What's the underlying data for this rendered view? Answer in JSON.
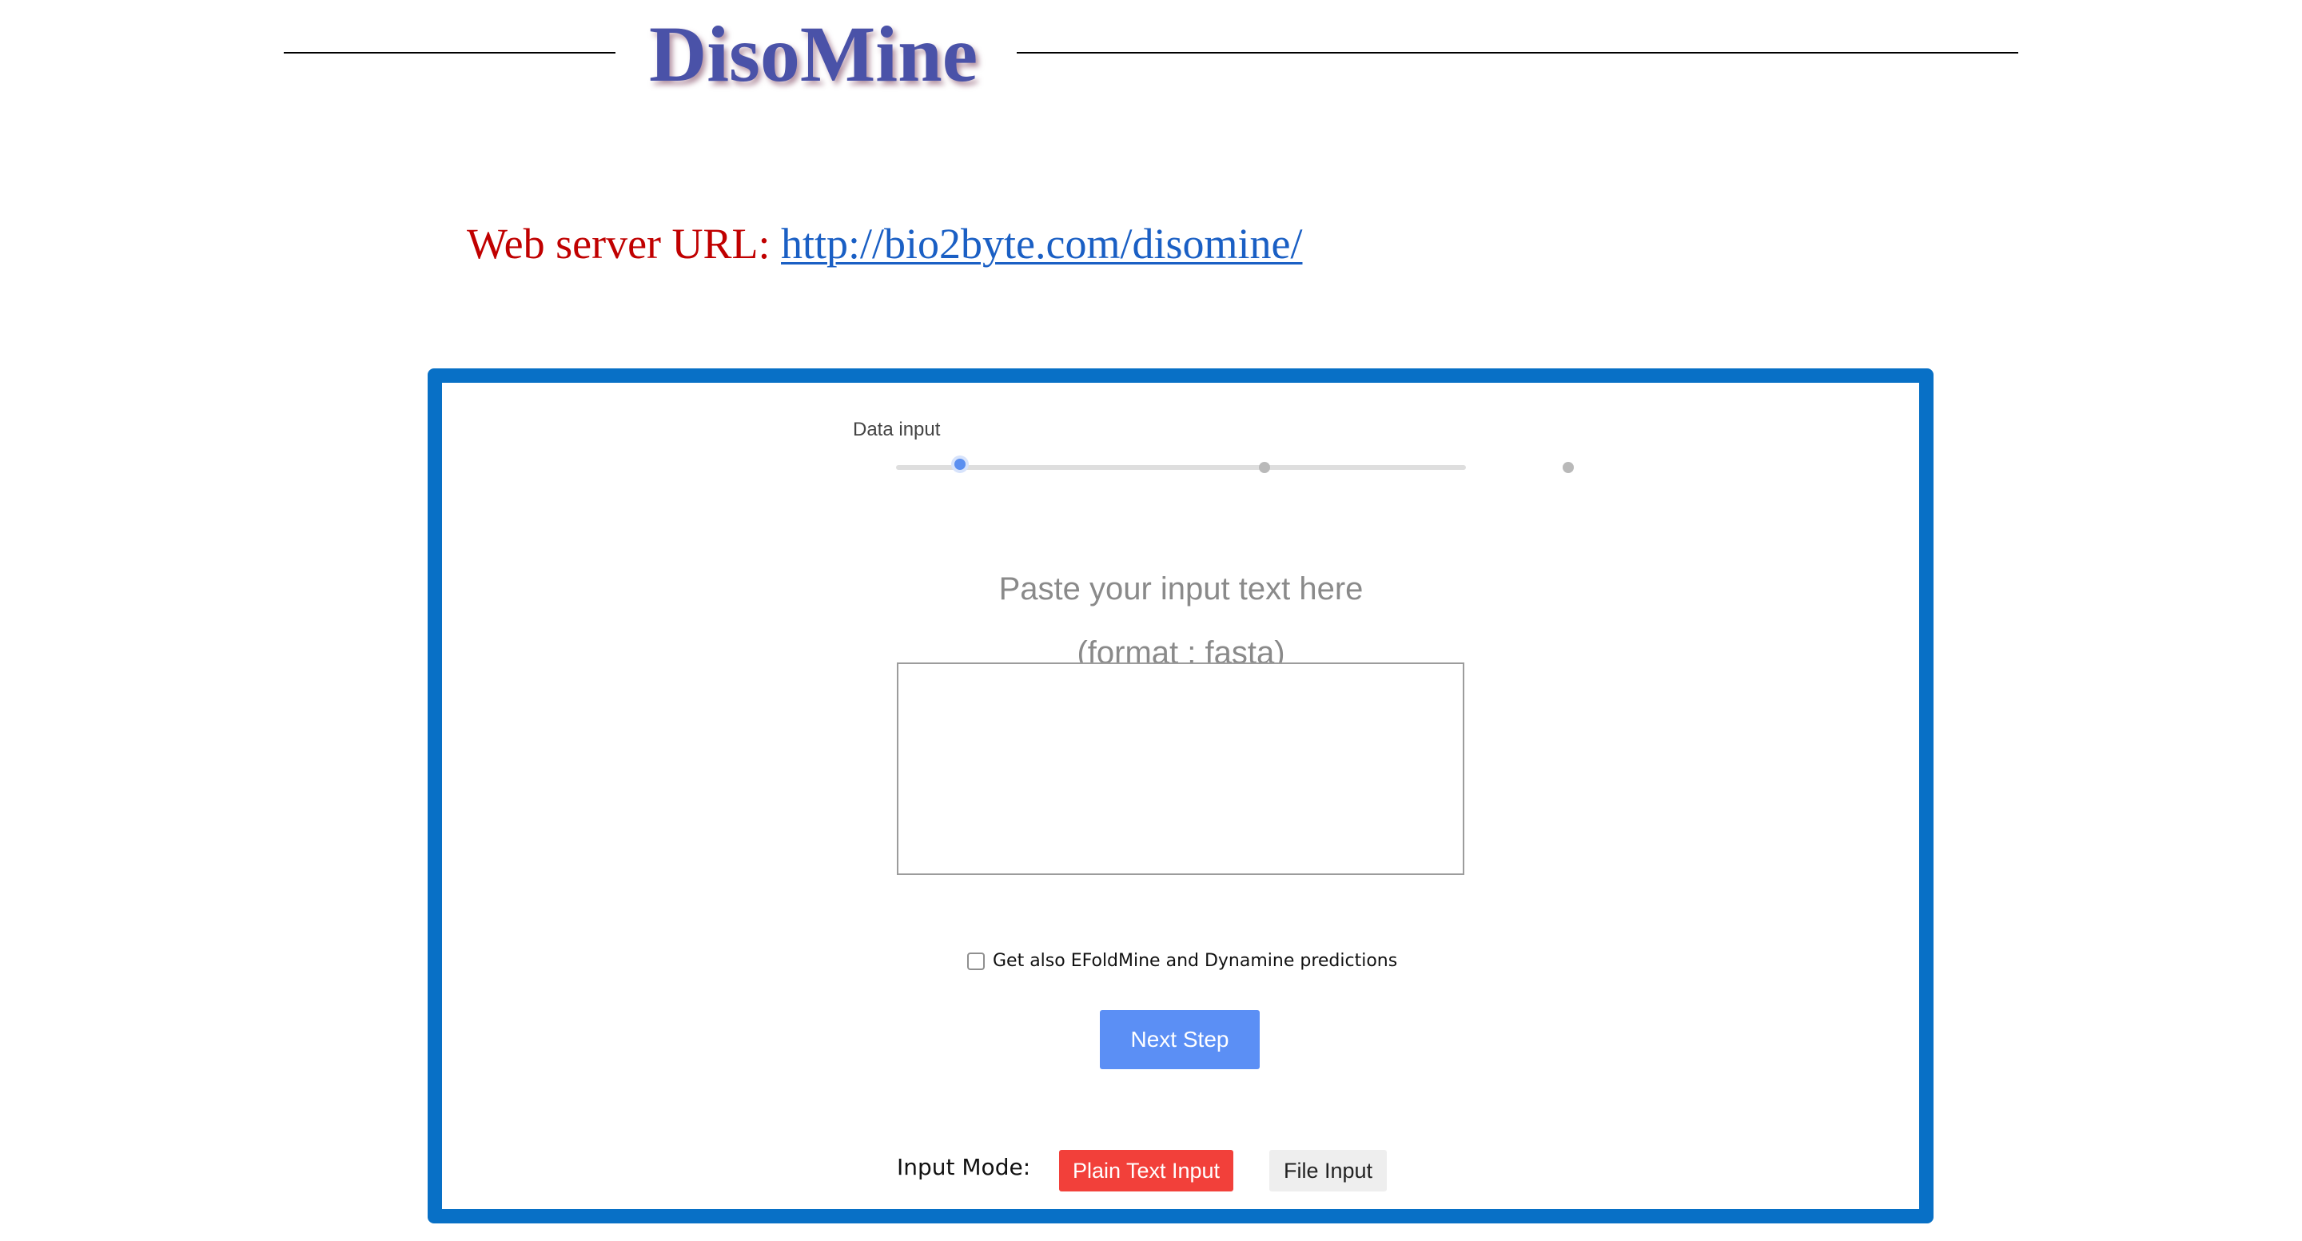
{
  "header": {
    "logo": "DisoMine"
  },
  "server": {
    "label": "Web server URL: ",
    "url": "http://bio2byte.com/disomine/"
  },
  "stepper": {
    "current_step_label": "Data input",
    "total_steps": 3,
    "current_step": 1
  },
  "input": {
    "prompt_line1": "Paste your input text here",
    "prompt_line2": "(format : fasta)",
    "value": ""
  },
  "options": {
    "extra_predictions_label": "Get also EFoldMine and Dynamine predictions",
    "extra_predictions_checked": false
  },
  "actions": {
    "next_label": "Next Step"
  },
  "mode": {
    "label": "Input Mode:",
    "plain_text_label": "Plain Text Input",
    "file_label": "File Input",
    "selected": "Plain Text Input"
  },
  "colors": {
    "panel_border": "#0870c6",
    "logo": "#4a52a8",
    "url_label": "#c00000",
    "link": "#1a5fc4",
    "primary_button": "#5b8ff5",
    "active_mode": "#f2403a"
  }
}
